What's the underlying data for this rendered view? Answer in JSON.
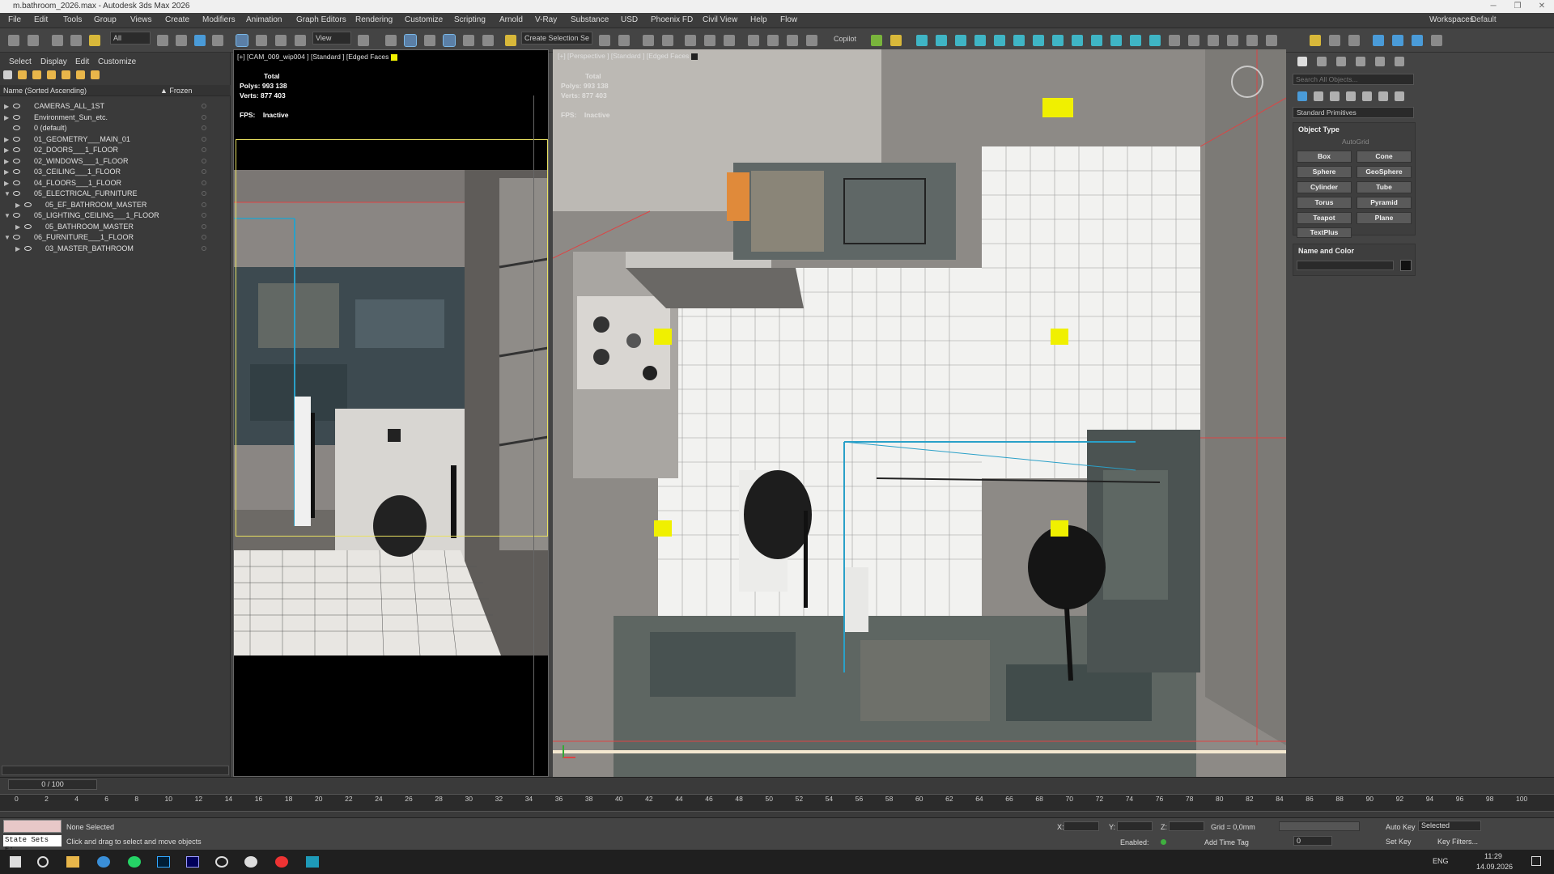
{
  "window": {
    "title": "m.bathroom_2026.max - Autodesk 3ds Max 2026"
  },
  "menu": [
    "File",
    "Edit",
    "Tools",
    "Group",
    "Views",
    "Create",
    "Modifiers",
    "Animation",
    "Graph Editors",
    "Rendering",
    "Customize",
    "Scripting",
    "Arnold",
    "V-Ray",
    "Substance",
    "USD",
    "Phoenix FD",
    "Civil View",
    "Help",
    "Flow"
  ],
  "workspaces": {
    "label": "Workspaces:",
    "value": "Default"
  },
  "toolbar": {
    "filter_value": "All",
    "ref_coord": "View",
    "selection_set_placeholder": "Create Selection Se",
    "copilot_label": "Copilot"
  },
  "explorer": {
    "tabs": [
      "Select",
      "Display",
      "Edit",
      "Customize"
    ],
    "col_name": "Name (Sorted Ascending)",
    "col_frozen": "▲ Frozen",
    "rows": [
      {
        "name": "CAMERAS_ALL_1ST",
        "depth": 0,
        "expand": "▶"
      },
      {
        "name": "Environment_Sun_etc.",
        "depth": 0,
        "expand": "▶"
      },
      {
        "name": "0 (default)",
        "depth": 0,
        "expand": ""
      },
      {
        "name": "01_GEOMETRY___MAIN_01",
        "depth": 0,
        "expand": "▶"
      },
      {
        "name": "02_DOORS___1_FLOOR",
        "depth": 0,
        "expand": "▶"
      },
      {
        "name": "02_WINDOWS___1_FLOOR",
        "depth": 0,
        "expand": "▶"
      },
      {
        "name": "03_CEILING___1_FLOOR",
        "depth": 0,
        "expand": "▶"
      },
      {
        "name": "04_FLOORS___1_FLOOR",
        "depth": 0,
        "expand": "▶"
      },
      {
        "name": "05_ELECTRICAL_FURNITURE",
        "depth": 0,
        "expand": "▼"
      },
      {
        "name": "05_EF_BATHROOM_MASTER",
        "depth": 1,
        "expand": "▶"
      },
      {
        "name": "05_LIGHTING_CEILING___1_FLOOR",
        "depth": 0,
        "expand": "▼"
      },
      {
        "name": "05_BATHROOM_MASTER",
        "depth": 1,
        "expand": "▶"
      },
      {
        "name": "06_FURNITURE___1_FLOOR",
        "depth": 0,
        "expand": "▼"
      },
      {
        "name": "03_MASTER_BATHROOM",
        "depth": 1,
        "expand": "▶"
      }
    ]
  },
  "viewport_left": {
    "label": "[+] [CAM_009_wip004 ] [Standard ] [Edged Faces ]",
    "stats_total": "Total",
    "polys_label": "Polys:",
    "polys": "993 138",
    "verts_label": "Verts:",
    "verts": "877 403",
    "fps_label": "FPS:",
    "fps": "Inactive"
  },
  "viewport_right": {
    "label": "[+] [Perspective ] [Standard ] [Edged Faces ]",
    "stats_total": "Total",
    "polys_label": "Polys:",
    "polys": "993 138",
    "verts_label": "Verts:",
    "verts": "877 403",
    "fps_label": "FPS:",
    "fps": "Inactive"
  },
  "command_panel": {
    "search_placeholder": "Search All Objects...",
    "category": "Standard Primitives",
    "object_type_title": "Object Type",
    "autogrid": "AutoGrid",
    "buttons": [
      "Box",
      "Cone",
      "Sphere",
      "GeoSphere",
      "Cylinder",
      "Tube",
      "Torus",
      "Pyramid",
      "Teapot",
      "Plane",
      "TextPlus"
    ],
    "name_color_title": "Name and Color"
  },
  "timeline": {
    "frame": "0 / 100",
    "ticks": [
      "0",
      "2",
      "4",
      "6",
      "8",
      "10",
      "12",
      "14",
      "16",
      "18",
      "20",
      "22",
      "24",
      "26",
      "28",
      "30",
      "32",
      "34",
      "36",
      "38",
      "40",
      "42",
      "44",
      "46",
      "48",
      "50",
      "52",
      "54",
      "56",
      "58",
      "60",
      "62",
      "64",
      "66",
      "68",
      "70",
      "72",
      "74",
      "76",
      "78",
      "80",
      "82",
      "84",
      "86",
      "88",
      "90",
      "92",
      "94",
      "96",
      "98",
      "100"
    ]
  },
  "status": {
    "selection": "None Selected",
    "prompt": "Click and drag to select and move objects",
    "state_sets": "State Sets E:",
    "x_label": "X:",
    "y_label": "Y:",
    "z_label": "Z:",
    "grid": "Grid = 0,0mm",
    "enabled": "Enabled:",
    "add_time_tag": "Add Time Tag",
    "auto_key": "Auto Key",
    "set_key": "Set Key",
    "key_mode": "Selected",
    "key_filters": "Key Filters...",
    "frame_field": "0"
  },
  "taskbar": {
    "lang": "ENG",
    "time": "11:29",
    "date": "14.09.2026"
  },
  "colors": {
    "accent": "#4a9bd8",
    "viewport_border_active": "#e8e060",
    "light_gizmo": "#f0f000",
    "shower_glass": "#2aa0c8"
  }
}
